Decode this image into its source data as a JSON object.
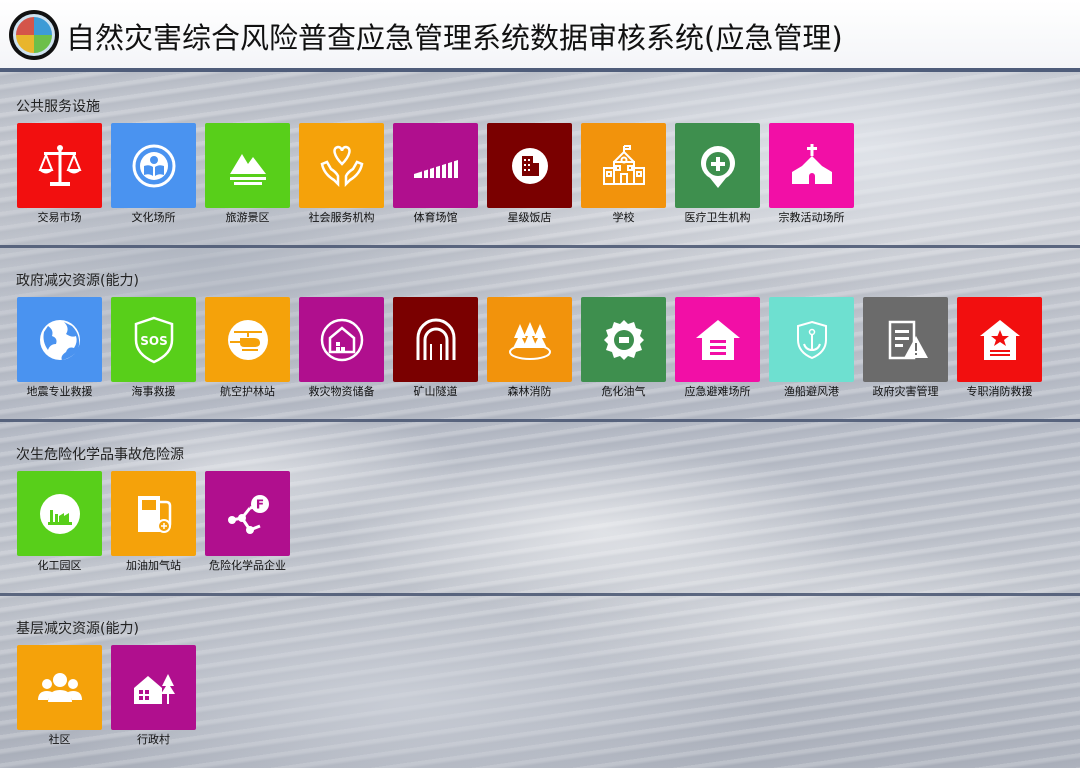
{
  "header": {
    "title": "自然灾害综合风险普查应急管理系统数据审核系统(应急管理)"
  },
  "sections": [
    {
      "title": "公共服务设施",
      "items": [
        {
          "label": "交易市场",
          "color": "#f20f0f",
          "icon": "scale-icon"
        },
        {
          "label": "文化场所",
          "color": "#4a93f0",
          "icon": "book-icon"
        },
        {
          "label": "旅游景区",
          "color": "#58cf1a",
          "icon": "mountain-icon"
        },
        {
          "label": "社会服务机构",
          "color": "#f5a20a",
          "icon": "heart-hands-icon"
        },
        {
          "label": "体育场馆",
          "color": "#b00f8e",
          "icon": "stadium-icon"
        },
        {
          "label": "星级饭店",
          "color": "#7a0000",
          "icon": "hotel-icon"
        },
        {
          "label": "学校",
          "color": "#f2930c",
          "icon": "school-icon"
        },
        {
          "label": "医疗卫生机构",
          "color": "#3e8f4e",
          "icon": "medical-pin-icon"
        },
        {
          "label": "宗教活动场所",
          "color": "#f20fa6",
          "icon": "church-icon"
        }
      ]
    },
    {
      "title": "政府减灾资源(能力)",
      "items": [
        {
          "label": "地震专业救援",
          "color": "#4a93f0",
          "icon": "globe-icon"
        },
        {
          "label": "海事救援",
          "color": "#58cf1a",
          "icon": "sos-shield-icon"
        },
        {
          "label": "航空护林站",
          "color": "#f5a20a",
          "icon": "helicopter-icon"
        },
        {
          "label": "救灾物资储备",
          "color": "#b00f8e",
          "icon": "warehouse-icon"
        },
        {
          "label": "矿山隧道",
          "color": "#7a0000",
          "icon": "tunnel-icon"
        },
        {
          "label": "森林消防",
          "color": "#f2930c",
          "icon": "forest-icon"
        },
        {
          "label": "危化油气",
          "color": "#3e8f4e",
          "icon": "hazard-gear-icon"
        },
        {
          "label": "应急避难场所",
          "color": "#f20fa6",
          "icon": "shelter-icon"
        },
        {
          "label": "渔船避风港",
          "color": "#6ee0d0",
          "icon": "anchor-shield-icon"
        },
        {
          "label": "政府灾害管理",
          "color": "#6b6b6b",
          "icon": "doc-alert-icon"
        },
        {
          "label": "专职消防救援",
          "color": "#f20f0f",
          "icon": "fire-station-icon"
        }
      ]
    },
    {
      "title": "次生危险化学品事故危险源",
      "items": [
        {
          "label": "化工园区",
          "color": "#58cf1a",
          "icon": "factory-icon"
        },
        {
          "label": "加油加气站",
          "color": "#f5a20a",
          "icon": "gas-pump-icon"
        },
        {
          "label": "危险化学品企业",
          "color": "#b00f8e",
          "icon": "molecule-icon"
        }
      ]
    },
    {
      "title": "基层减灾资源(能力)",
      "items": [
        {
          "label": "社区",
          "color": "#f5a20a",
          "icon": "people-icon"
        },
        {
          "label": "行政村",
          "color": "#b00f8e",
          "icon": "village-icon"
        }
      ]
    }
  ]
}
